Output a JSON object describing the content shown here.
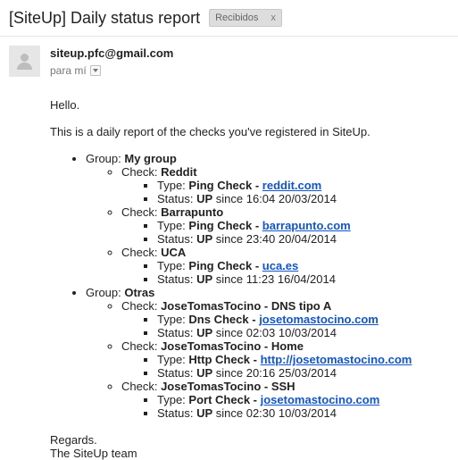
{
  "email": {
    "subject": "[SiteUp] Daily status report",
    "label": "Recibidos",
    "label_remove": "x",
    "sender": "siteup.pfc@gmail.com",
    "recipient": "para mí"
  },
  "body": {
    "greeting": "Hello.",
    "intro": "This is a daily report of the checks you've registered in SiteUp.",
    "group_prefix": "Group: ",
    "check_prefix": "Check: ",
    "type_prefix": "Type: ",
    "status_prefix": "Status: ",
    "link_separator": " - ",
    "since_word": " since ",
    "groups": [
      {
        "name": "My group",
        "checks": [
          {
            "name": "Reddit",
            "type": "Ping Check",
            "link": "reddit.com",
            "status": "UP",
            "since": "16:04 20/03/2014"
          },
          {
            "name": "Barrapunto",
            "type": "Ping Check",
            "link": "barrapunto.com",
            "status": "UP",
            "since": "23:40 20/04/2014"
          },
          {
            "name": "UCA",
            "type": "Ping Check",
            "link": "uca.es",
            "status": "UP",
            "since": "11:23 16/04/2014"
          }
        ]
      },
      {
        "name": "Otras",
        "checks": [
          {
            "name": "JoseTomasTocino - DNS tipo A",
            "type": "Dns Check",
            "link": "josetomastocino.com",
            "status": "UP",
            "since": "02:03 10/03/2014"
          },
          {
            "name": "JoseTomasTocino - Home",
            "type": "Http Check",
            "link": "http://josetomastocino.com",
            "status": "UP",
            "since": "20:16 25/03/2014"
          },
          {
            "name": "JoseTomasTocino - SSH",
            "type": "Port Check",
            "link": "josetomastocino.com",
            "status": "UP",
            "since": "02:30 10/03/2014"
          }
        ]
      }
    ],
    "regards": "Regards.",
    "signature": "The SiteUp team"
  }
}
